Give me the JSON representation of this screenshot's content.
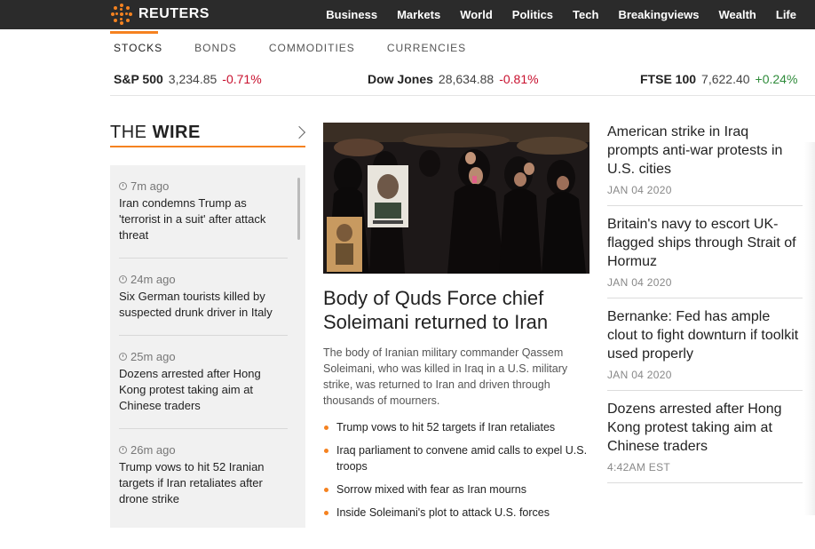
{
  "brand": {
    "name": "REUTERS",
    "accent": "#f58220"
  },
  "nav": {
    "items": [
      "Business",
      "Markets",
      "World",
      "Politics",
      "Tech",
      "Breakingviews",
      "Wealth",
      "Life"
    ]
  },
  "market_tabs": {
    "items": [
      "STOCKS",
      "BONDS",
      "COMMODITIES",
      "CURRENCIES"
    ],
    "active": "STOCKS"
  },
  "quotes": [
    {
      "name": "S&P 500",
      "value": "3,234.85",
      "change": "-0.71%",
      "direction": "down"
    },
    {
      "name": "Dow Jones",
      "value": "28,634.88",
      "change": "-0.81%",
      "direction": "down"
    },
    {
      "name": "FTSE 100",
      "value": "7,622.40",
      "change": "+0.24%",
      "direction": "up"
    }
  ],
  "wire": {
    "title_light": "THE ",
    "title_bold": "WIRE",
    "items": [
      {
        "time": "7m ago",
        "text": "Iran condemns Trump as 'terrorist in a suit' after attack threat"
      },
      {
        "time": "24m ago",
        "text": "Six German tourists killed by suspected drunk driver in Italy"
      },
      {
        "time": "25m ago",
        "text": "Dozens arrested after Hong Kong protest taking aim at Chinese traders"
      },
      {
        "time": "26m ago",
        "text": "Trump vows to hit 52 Iranian targets if Iran retaliates after drone strike"
      }
    ]
  },
  "main_story": {
    "headline": "Body of Quds Force chief Soleimani returned to Iran",
    "summary": "The body of Iranian military commander Qassem Soleimani, who was killed in Iraq in a U.S. military strike, was returned to Iran and driven through thousands of mourners.",
    "related": [
      "Trump vows to hit 52 targets if Iran retaliates",
      "Iraq parliament to convene amid calls to expel U.S. troops",
      "Sorrow mixed with fear as Iran mourns",
      "Inside Soleimani's plot to attack U.S. forces"
    ]
  },
  "side_stories": [
    {
      "title": "American strike in Iraq prompts anti-war protests in U.S. cities",
      "date": "JAN 04 2020"
    },
    {
      "title": "Britain's navy to escort UK-flagged ships through Strait of Hormuz",
      "date": "JAN 04 2020"
    },
    {
      "title": "Bernanke: Fed has ample clout to fight downturn if toolkit used properly",
      "date": "JAN 04 2020"
    },
    {
      "title": "Dozens arrested after Hong Kong protest taking aim at Chinese traders",
      "date": "4:42AM EST"
    }
  ]
}
